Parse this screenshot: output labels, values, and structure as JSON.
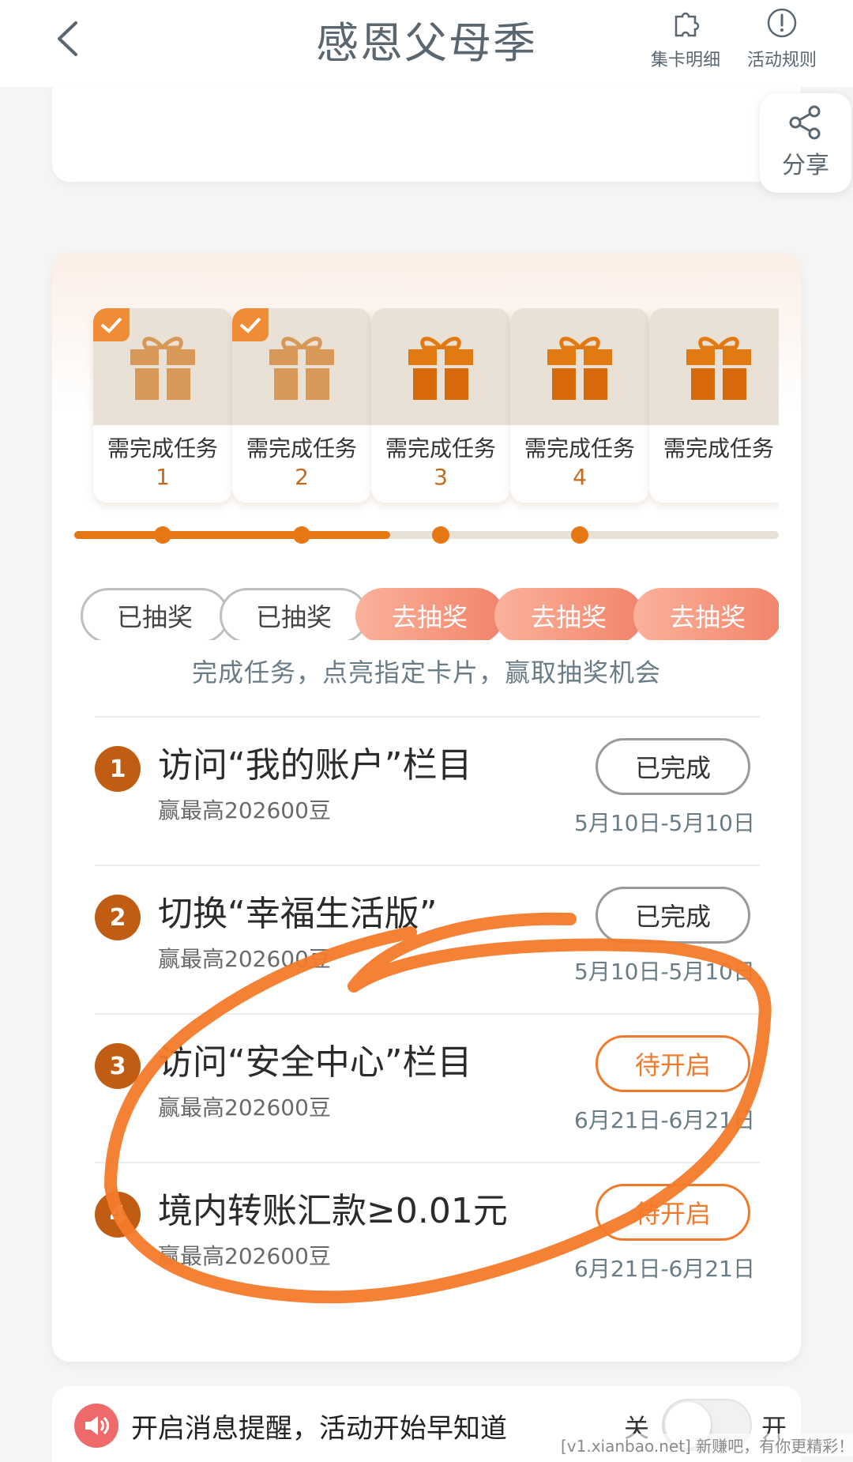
{
  "header": {
    "title": "感恩父母季",
    "actions": [
      {
        "label": "集卡明细",
        "icon": "puzzle-icon"
      },
      {
        "label": "活动规则",
        "icon": "info-circle-icon"
      }
    ],
    "back_icon": "chevron-left-icon"
  },
  "share": {
    "label": "分享",
    "icon": "share-icon"
  },
  "stages": [
    {
      "line1": "需完成任务",
      "num": "1",
      "checked": true,
      "lottery": "已抽奖",
      "state": "done"
    },
    {
      "line1": "需完成任务",
      "num": "2",
      "checked": true,
      "lottery": "已抽奖",
      "state": "done"
    },
    {
      "line1": "需完成任务",
      "num": "3",
      "checked": false,
      "lottery": "去抽奖",
      "state": "go"
    },
    {
      "line1": "需完成任务",
      "num": "4",
      "checked": false,
      "lottery": "去抽奖",
      "state": "go"
    },
    {
      "line1": "需完成任务",
      "num": "",
      "checked": false,
      "lottery": "去抽奖",
      "state": "go"
    }
  ],
  "hint": "完成任务，点亮指定卡片，赢取抽奖机会",
  "tasks": [
    {
      "num": "1",
      "title": "访问“我的账户”栏目",
      "reward": "赢最高202600豆",
      "button": "已完成",
      "state": "done",
      "date": "5月10日-5月10日"
    },
    {
      "num": "2",
      "title": "切换“幸福生活版”",
      "reward": "赢最高202600豆",
      "button": "已完成",
      "state": "done",
      "date": "5月10日-5月10日"
    },
    {
      "num": "3",
      "title": "访问“安全中心”栏目",
      "reward": "赢最高202600豆",
      "button": "待开启",
      "state": "pending",
      "date": "6月21日-6月21日"
    },
    {
      "num": "4",
      "title": "境内转账汇款≥0.01元",
      "reward": "赢最高202600豆",
      "button": "待开启",
      "state": "pending",
      "date": "6月21日-6月21日"
    }
  ],
  "notify": {
    "text": "开启消息提醒，活动开始早知道",
    "off_label": "关",
    "on_label": "开",
    "toggle_on": false,
    "icon": "speaker-icon"
  },
  "watermark": "[v1.xianbao.net] 新赚吧，有你更精彩！",
  "colors": {
    "accent": "#e67814",
    "scribble": "#f47a2a",
    "badge": "#c15d12"
  }
}
